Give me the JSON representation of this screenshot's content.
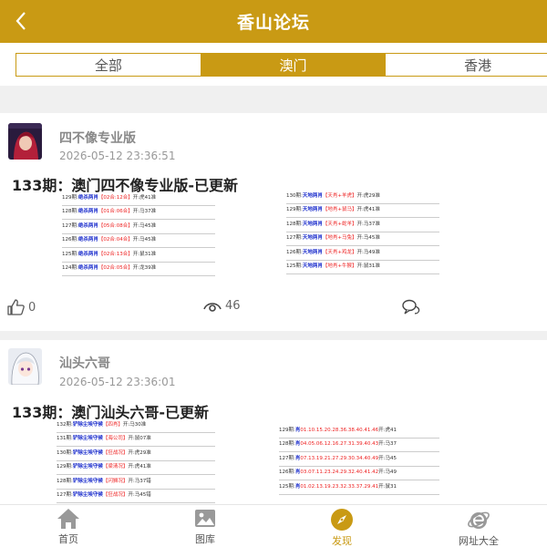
{
  "header": {
    "title": "香山论坛",
    "back_icon": "chevron-left-icon"
  },
  "tabs": [
    {
      "label": "全部",
      "active": false
    },
    {
      "label": "澳门",
      "active": true
    },
    {
      "label": "香港",
      "active": false
    }
  ],
  "colors": {
    "accent": "#c99a14",
    "blue": "#1a2ccc",
    "red": "#e22222"
  },
  "posts": [
    {
      "author": "四不像专业版",
      "time": "2026-05-12 23:36:51",
      "title": "133期：澳门四不像专业版-已更新",
      "table_left": [
        {
          "period": "129期:",
          "kind": "绝杀两肖",
          "pick": "【02合:12合】",
          "open": "开:虎41准"
        },
        {
          "period": "128期:",
          "kind": "绝杀两肖",
          "pick": "【01合:06合】",
          "open": "开:马37准"
        },
        {
          "period": "127期:",
          "kind": "绝杀两肖",
          "pick": "【05合:08合】",
          "open": "开:马45准"
        },
        {
          "period": "126期:",
          "kind": "绝杀两肖",
          "pick": "【02合:04合】",
          "open": "开:马45准"
        },
        {
          "period": "125期:",
          "kind": "绝杀两肖",
          "pick": "【02合:13合】",
          "open": "开:鼠31准"
        },
        {
          "period": "124期:",
          "kind": "绝杀两肖",
          "pick": "【02合:05合】",
          "open": "开:龙39准"
        }
      ],
      "table_right": [
        {
          "period": "130期:",
          "kind": "天地两肖",
          "pick": "【天肖+羊虎】",
          "open": "开:虎29准"
        },
        {
          "period": "129期:",
          "kind": "天地两肖",
          "pick": "【地肖+鼠马】",
          "open": "开:虎41准"
        },
        {
          "period": "128期:",
          "kind": "天地两肖",
          "pick": "【天肖+蛇羊】",
          "open": "开:马37准"
        },
        {
          "period": "127期:",
          "kind": "天地两肖",
          "pick": "【地肖+马兔】",
          "open": "开:马45准"
        },
        {
          "period": "126期:",
          "kind": "天地两肖",
          "pick": "【天肖+鸡龙】",
          "open": "开:马49准"
        },
        {
          "period": "125期:",
          "kind": "天地两肖",
          "pick": "【地肖+牛猴】",
          "open": "开:鼠31准"
        }
      ],
      "likes": "0",
      "views": "46"
    },
    {
      "author": "汕头六哥",
      "time": "2026-05-12 23:36:01",
      "title": "133期：澳门汕头六哥-已更新",
      "table_left": [
        {
          "period": "132期:",
          "kind": "铲除尘埃守候",
          "pick": "【四肖】",
          "open": "开:马30准"
        },
        {
          "period": "131期:",
          "kind": "铲除尘埃守候",
          "pick": "【海公司】",
          "open": "开:鼠07准"
        },
        {
          "period": "130期:",
          "kind": "铲除尘埃守候",
          "pick": "【狂战况】",
          "open": "开:虎29准"
        },
        {
          "period": "129期:",
          "kind": "铲除尘埃守候",
          "pick": "【梁清况】",
          "open": "开:虎41准"
        },
        {
          "period": "128期:",
          "kind": "铲除尘埃守候",
          "pick": "【闪狮况】",
          "open": "开:马37错"
        },
        {
          "period": "127期:",
          "kind": "铲除尘埃守候",
          "pick": "【狂战况】",
          "open": "开:马45错"
        }
      ],
      "table_right": [
        {
          "period": "129期:",
          "kind": "肖",
          "pick": "01.10.15.20.28.36.38.40.41.46",
          "open": "开:虎41"
        },
        {
          "period": "128期:",
          "kind": "肖",
          "pick": "04.05.06.12.16.27.31.39.40.43",
          "open": "开:马37"
        },
        {
          "period": "127期:",
          "kind": "肖",
          "pick": "07.13.19.21.27.29.30.34.40.49",
          "open": "开:马45"
        },
        {
          "period": "126期:",
          "kind": "肖",
          "pick": "03.07.11.23.24.29.32.40.41.42",
          "open": "开:马49"
        },
        {
          "period": "125期:",
          "kind": "肖",
          "pick": "01.02.13.19.23.32.33.37.29.41",
          "open": "开:鼠31"
        }
      ]
    }
  ],
  "bottom_nav": [
    {
      "label": "首页",
      "icon": "home-icon",
      "active": false
    },
    {
      "label": "图库",
      "icon": "gallery-icon",
      "active": false
    },
    {
      "label": "发现",
      "icon": "compass-icon",
      "active": true
    },
    {
      "label": "网址大全",
      "icon": "browser-e-icon",
      "active": false
    }
  ]
}
